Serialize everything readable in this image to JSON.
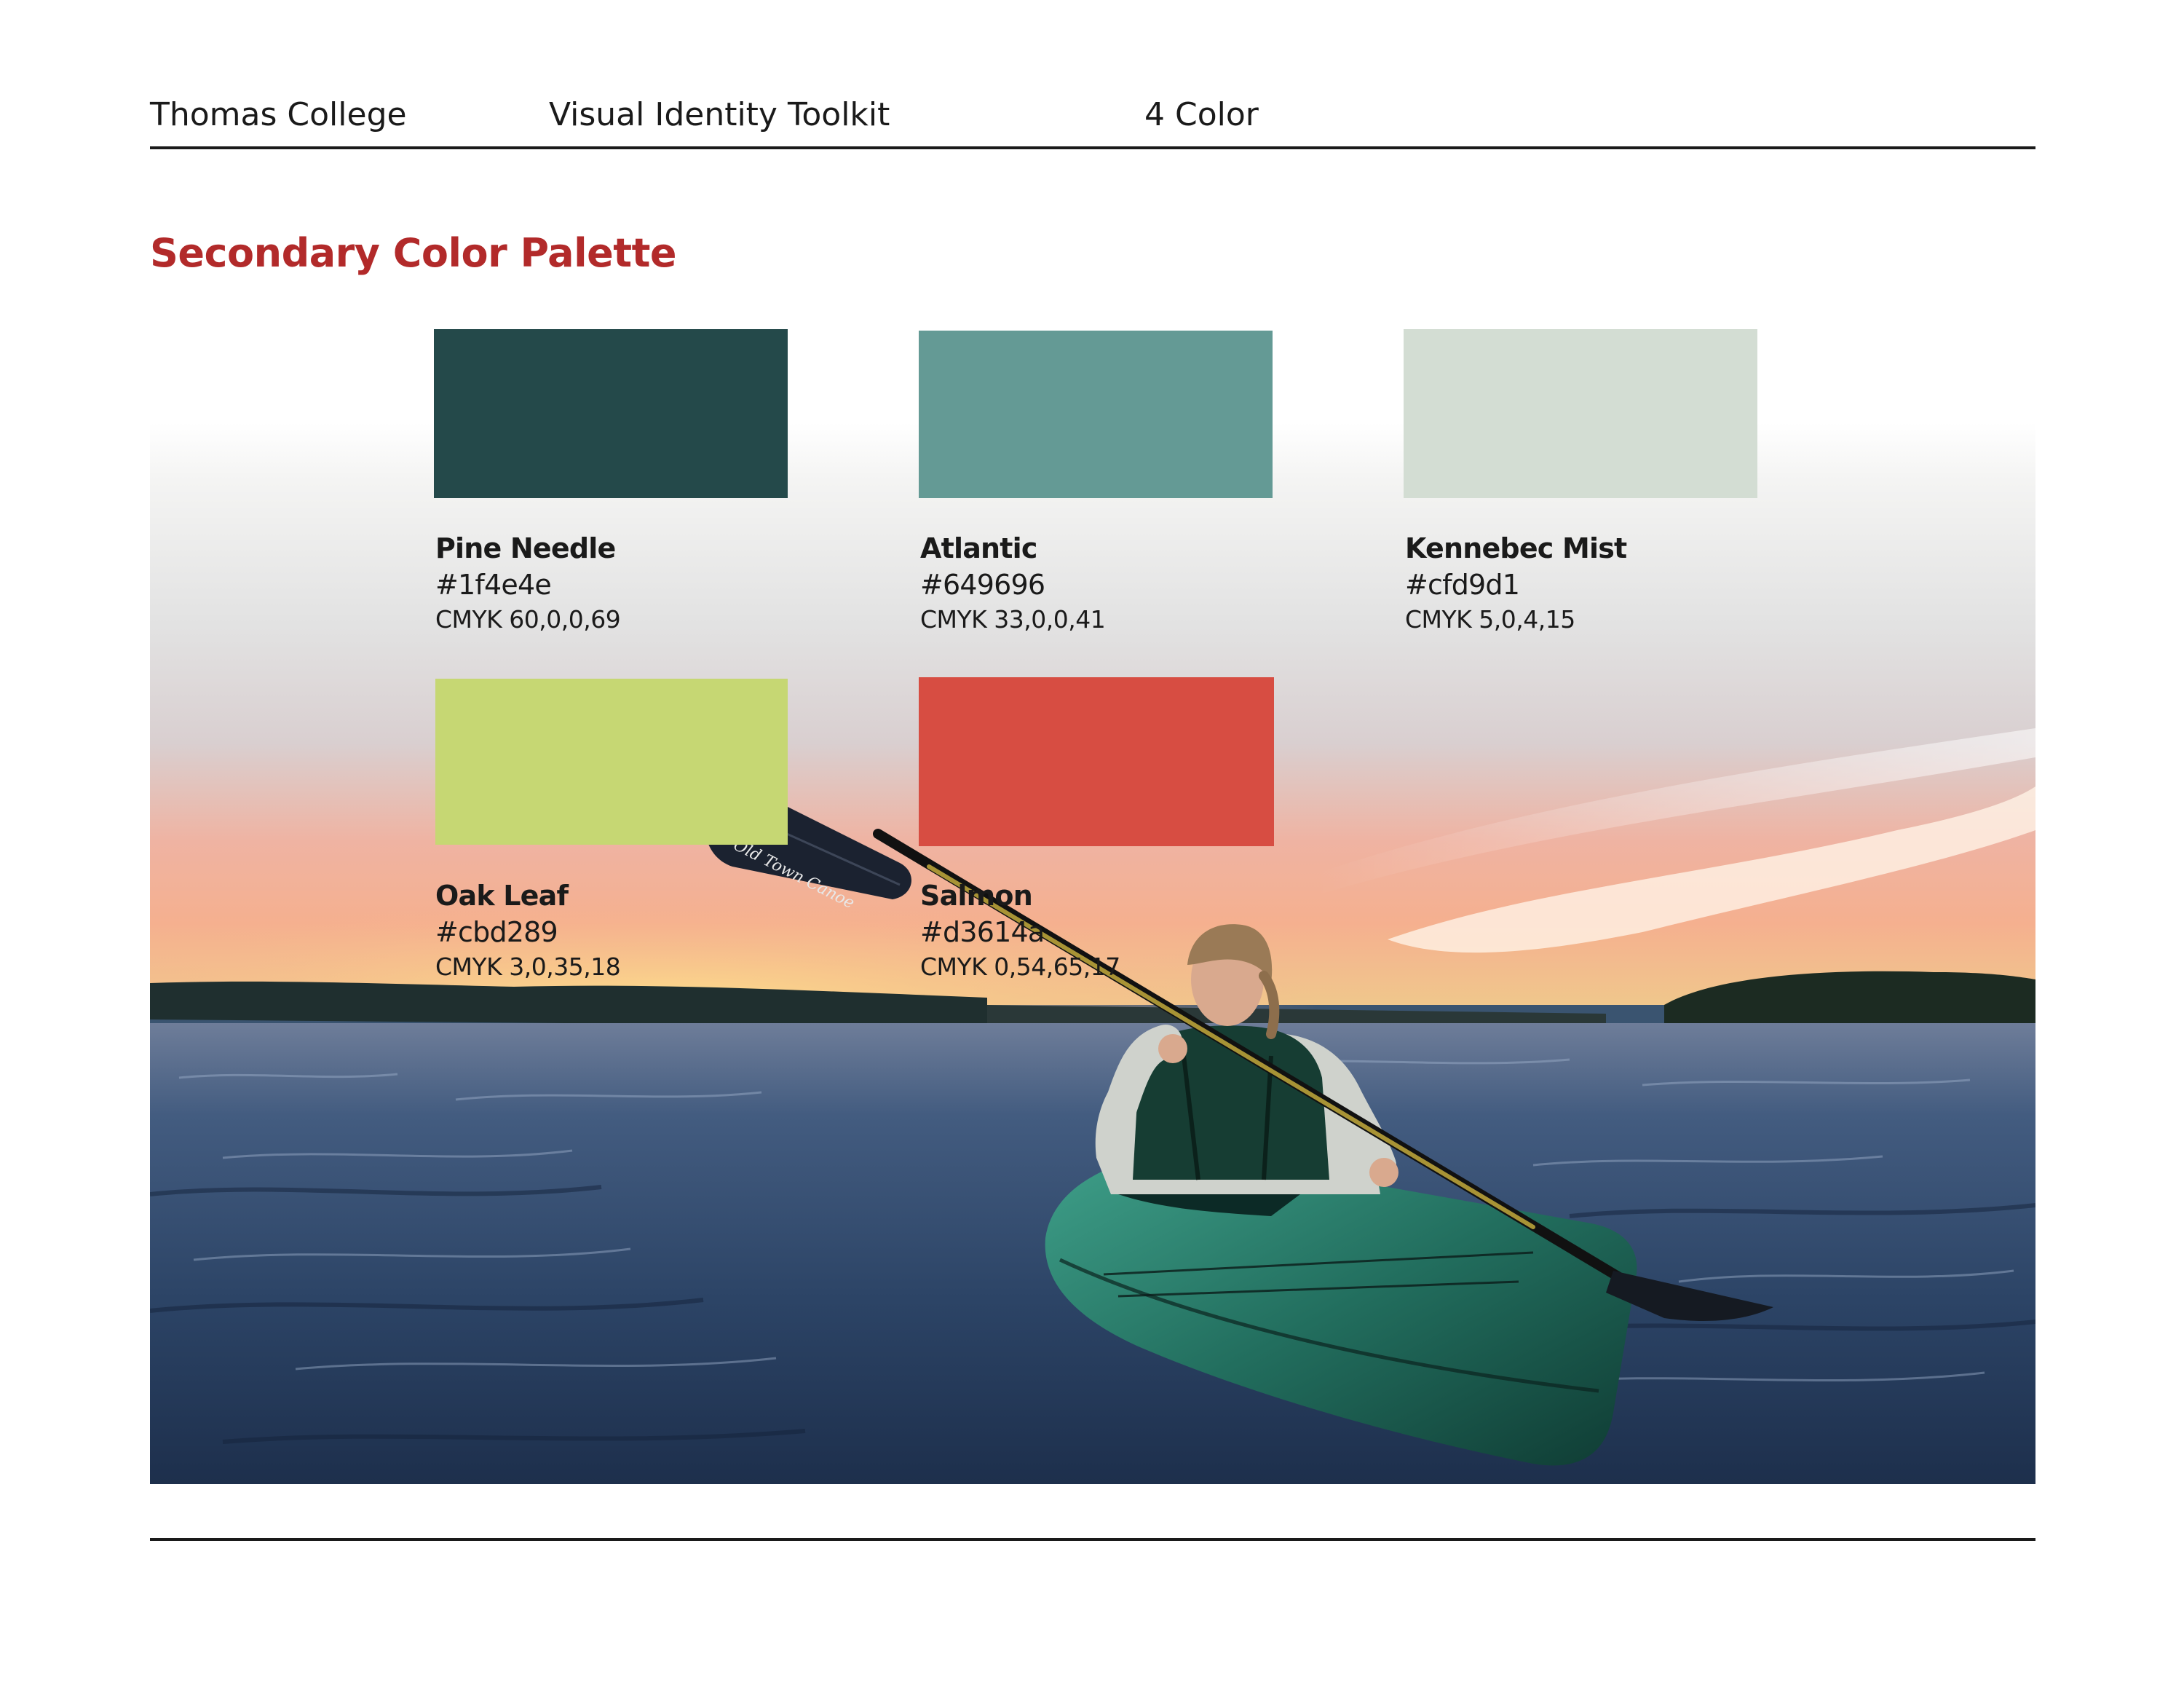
{
  "header": {
    "college": "Thomas College",
    "toolkit": "Visual Identity Toolkit",
    "color_mode": "4 Color"
  },
  "section": {
    "title": "Secondary Color Palette"
  },
  "swatches": [
    {
      "name": "Pine Needle",
      "hex": "#1f4e4e",
      "cmyk": "CMYK  60,0,0,69",
      "color": "#24494a"
    },
    {
      "name": "Atlantic",
      "hex": "#649696",
      "cmyk": "CMYK 33,0,0,41",
      "color": "#649a95"
    },
    {
      "name": "Kennebec Mist",
      "hex": "#cfd9d1",
      "cmyk": "CMYK 5,0,4,15",
      "color": "#d3ddd3"
    },
    {
      "name": "Oak Leaf",
      "hex": "#cbd289",
      "cmyk": "CMYK 3,0,35,18",
      "color": "#c6d773"
    },
    {
      "name": "Salmon",
      "hex": "#d3614a",
      "cmyk": "CMYK 0,54,65,17",
      "color": "#d74d42"
    }
  ],
  "photo": {
    "subject": "kayaker-at-sunset",
    "paddle_brand": "Old Town Canoe"
  }
}
